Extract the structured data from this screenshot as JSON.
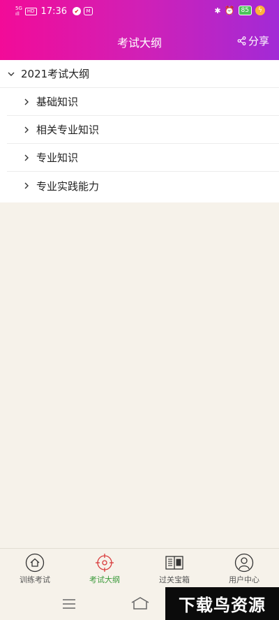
{
  "status_bar": {
    "signal_top": "5G",
    "signal_bottom": "ıll",
    "hd": "HD",
    "time": "17:36",
    "battery": "85"
  },
  "header": {
    "title": "考试大纲",
    "share_label": "分享"
  },
  "outline": {
    "root_label": "2021考试大纲",
    "children": [
      {
        "label": "基础知识"
      },
      {
        "label": "相关专业知识"
      },
      {
        "label": "专业知识"
      },
      {
        "label": "专业实践能力"
      }
    ]
  },
  "tabs": [
    {
      "label": "训练考试",
      "icon": "home-icon"
    },
    {
      "label": "考试大纲",
      "icon": "target-icon",
      "active": true
    },
    {
      "label": "过关宝箱",
      "icon": "book-icon"
    },
    {
      "label": "用户中心",
      "icon": "user-icon"
    }
  ],
  "colors": {
    "header_start": "#f20b98",
    "header_end": "#a22ad6",
    "active_tab": "#3a9a3a",
    "active_icon": "#d93a3a"
  },
  "watermark": {
    "text": "下载鸟资源"
  }
}
